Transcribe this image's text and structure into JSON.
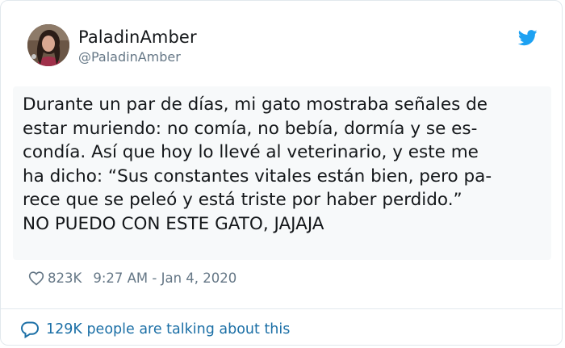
{
  "tweet": {
    "author": {
      "display_name": "PaladinAmber",
      "handle": "@PaladinAmber",
      "avatar_icon": "user-avatar"
    },
    "brand_icon": "twitter-bird-icon",
    "brand_color": "#1da1f2",
    "text_lines": [
      "Durante un par de días, mi gato mostraba señales de",
      "estar muriendo: no comía, no bebía, dormía y se es-",
      "condía. Así que hoy lo llevé al veterinario, y este me",
      "ha dicho: “Sus constantes vitales están bien, pero pa-",
      "rece que se peleó y está triste por haber perdido.”",
      "NO PUEDO CON ESTE GATO, JAJAJA"
    ],
    "likes": "823K",
    "timestamp": "9:27 AM - Jan 4, 2020",
    "conversation": "129K people are talking about this",
    "link_color": "#1b6fa6"
  }
}
